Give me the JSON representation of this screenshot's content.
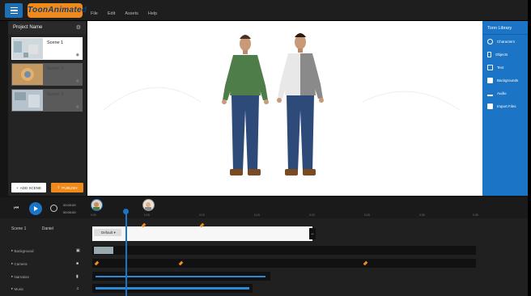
{
  "app": {
    "logo_text": "ToonAnimated",
    "menu": [
      "File",
      "Edit",
      "Assets",
      "Help"
    ]
  },
  "sidebar": {
    "project_name": "Project Name",
    "scenes": [
      {
        "label": "Scene 1",
        "active": true
      },
      {
        "label": "Scene 2",
        "active": false
      },
      {
        "label": "Scene 3",
        "active": false
      }
    ],
    "add_scene_label": "ADD SCENE",
    "publish_label": "PUBLISH"
  },
  "library": {
    "title": "Toon Library",
    "items": [
      {
        "label": "Characters",
        "icon": "character-icon"
      },
      {
        "label": "Objects",
        "icon": "object-icon"
      },
      {
        "label": "Text",
        "icon": "text-icon"
      },
      {
        "label": "Backgrounds",
        "icon": "background-icon"
      },
      {
        "label": "Audio",
        "icon": "audio-icon"
      },
      {
        "label": "Import Files",
        "icon": "import-icon"
      }
    ]
  },
  "playback": {
    "time_current": "00:00:00",
    "time_total": "00:00:00"
  },
  "timeline": {
    "scene_label": "Scene 1",
    "track_select": "Daniel",
    "dropdown_label": "Default",
    "rows": [
      "Background",
      "Camera",
      "Narration",
      "Music"
    ],
    "ruler": [
      "0:00",
      "0:05",
      "0:10",
      "0:15",
      "0:20",
      "0:25",
      "0:30",
      "0:35"
    ]
  },
  "colors": {
    "accent_blue": "#1b74c5",
    "accent_orange": "#f08a1a"
  }
}
